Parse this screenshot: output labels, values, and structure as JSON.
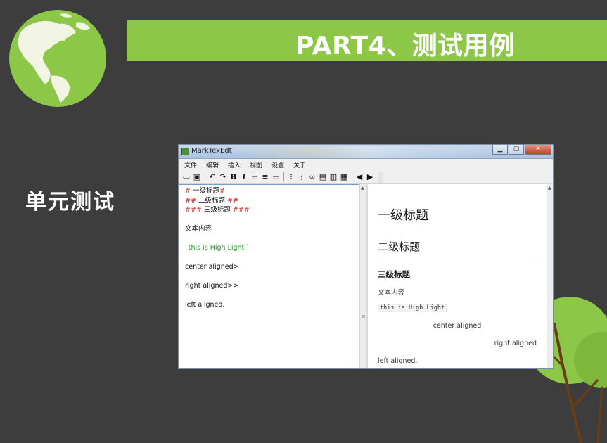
{
  "slide": {
    "title": "PART4、测试用例",
    "section_label": "单元测试",
    "accent_color": "#8cc748",
    "background_color": "#3d3d3d"
  },
  "window": {
    "title": "MarkTexEdt",
    "controls": [
      "minimize-icon",
      "maximize-icon",
      "close-icon"
    ]
  },
  "menu": {
    "items": [
      "文件",
      "编辑",
      "插入",
      "视图",
      "设置",
      "关于"
    ]
  },
  "toolbar": {
    "icons": [
      "open-folder-icon",
      "save-icon",
      "undo-icon",
      "redo-icon",
      "bold-icon",
      "italic-icon",
      "align-left-icon",
      "align-center-icon",
      "align-right-icon",
      "bullet-list-icon",
      "numbered-list-icon",
      "link-icon",
      "image-icon",
      "formula-icon",
      "table-icon",
      "back-arrow-icon",
      "forward-arrow-icon"
    ],
    "bold_label": "B",
    "italic_label": "I"
  },
  "editor": {
    "h1_prefix": "# ",
    "h1_text": "一级标题",
    "h1_suffix": "#",
    "h2_prefix": "## ",
    "h2_text": "二级标题",
    "h2_suffix": " ##",
    "h3_prefix": "### ",
    "h3_text": "三级标题",
    "h3_suffix": " ###",
    "body": "文本内容",
    "code": "`this is High Light `",
    "center": "center aligned>",
    "right": "right aligned>>",
    "left": "left aligned."
  },
  "preview": {
    "h1": "一级标题",
    "h2": "二级标题",
    "h3": "三级标题",
    "body": "文本内容",
    "code": "this is High Light",
    "center": "center aligned",
    "right": "right aligned",
    "left": "left aligned."
  }
}
